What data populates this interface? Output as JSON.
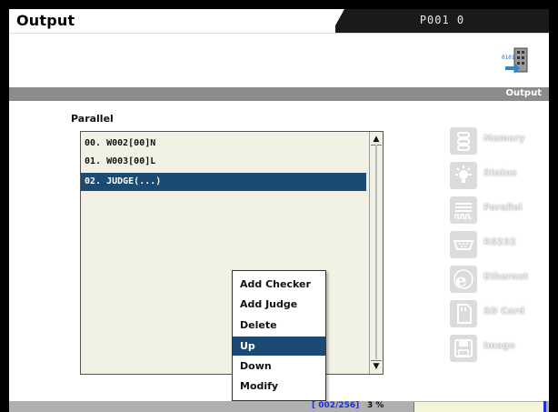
{
  "window": {
    "title": "Output",
    "program": "P001 0"
  },
  "section": {
    "label": "Output"
  },
  "parallel": {
    "label": "Parallel",
    "items": [
      {
        "text": "00. W002[00]N"
      },
      {
        "text": "01. W003[00]L"
      },
      {
        "text": "02. JUDGE(...)"
      }
    ]
  },
  "context_menu": {
    "items": [
      {
        "label": "Add Checker"
      },
      {
        "label": "Add Judge"
      },
      {
        "label": "Delete"
      },
      {
        "label": "Up"
      },
      {
        "label": "Down"
      },
      {
        "label": "Modify"
      }
    ],
    "highlighted": "Up"
  },
  "nav": {
    "items": [
      {
        "label": "Memory",
        "icon": "memory-icon"
      },
      {
        "label": "Status",
        "icon": "status-icon"
      },
      {
        "label": "Parallel",
        "icon": "parallel-icon"
      },
      {
        "label": "RS232",
        "icon": "rs232-icon"
      },
      {
        "label": "Ethernet",
        "icon": "ethernet-icon"
      },
      {
        "label": "SD Card",
        "icon": "sd-card-icon"
      },
      {
        "label": "Image",
        "icon": "image-icon"
      }
    ]
  },
  "status": {
    "counter": "[ 002/256]",
    "percent": "3 %"
  },
  "colors": {
    "selection": "#1b4b72",
    "counter": "#1c2fd6",
    "bar": "#8c8c8c"
  }
}
